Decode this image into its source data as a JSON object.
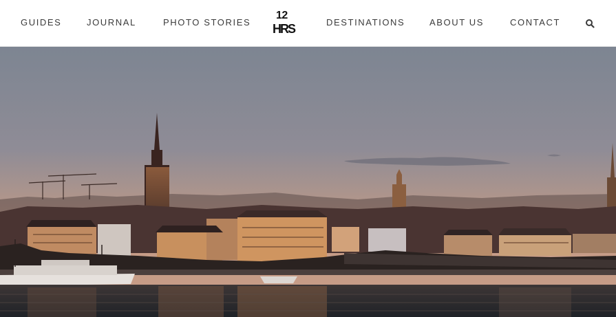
{
  "nav": {
    "items": [
      {
        "label": "GUIDES"
      },
      {
        "label": "JOURNAL"
      },
      {
        "label": "PHOTO STORIES"
      },
      {
        "label": "DESTINATIONS"
      },
      {
        "label": "ABOUT US"
      },
      {
        "label": "CONTACT"
      }
    ],
    "search_icon": "search-icon"
  },
  "logo": {
    "number": "12",
    "word": "HRS"
  },
  "hero": {
    "subject": "city skyline at sunset over water"
  },
  "colors": {
    "nav_text": "#3a3a3a",
    "navbar_bg": "#ffffff",
    "sky_top": "#7f8794",
    "sky_horizon": "#c49886",
    "water": "#2c2a2c"
  }
}
